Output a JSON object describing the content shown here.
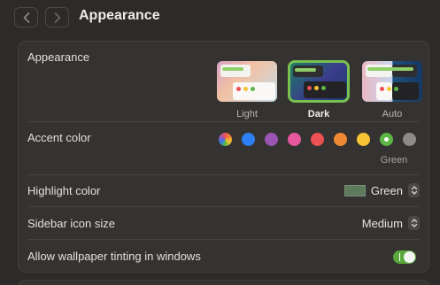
{
  "window": {
    "title": "Appearance",
    "nav_back_icon": "chevron-left-icon",
    "nav_forward_icon": "chevron-right-icon"
  },
  "appearance": {
    "label": "Appearance",
    "options": [
      {
        "label": "Light",
        "selected": false
      },
      {
        "label": "Dark",
        "selected": true
      },
      {
        "label": "Auto",
        "selected": false
      }
    ],
    "selected_color": "#78c04f"
  },
  "accent": {
    "label": "Accent color",
    "selected_name": "Green",
    "swatches": [
      {
        "name": "multicolor",
        "color": "conic"
      },
      {
        "name": "blue",
        "color": "#2d7ff3"
      },
      {
        "name": "purple",
        "color": "#9b55b5"
      },
      {
        "name": "pink",
        "color": "#e7579d"
      },
      {
        "name": "red",
        "color": "#ec5254"
      },
      {
        "name": "orange",
        "color": "#ef8a34"
      },
      {
        "name": "yellow",
        "color": "#f7c433"
      },
      {
        "name": "green",
        "color": "#5db646"
      },
      {
        "name": "graphite",
        "color": "#8d8b89"
      }
    ]
  },
  "highlight": {
    "label": "Highlight color",
    "value": "Green",
    "swatch_color": "#5e7a5c"
  },
  "sidebar": {
    "label": "Sidebar icon size",
    "value": "Medium"
  },
  "tinting": {
    "label": "Allow wallpaper tinting in windows",
    "enabled": true,
    "toggle_color": "#5aa83c"
  }
}
